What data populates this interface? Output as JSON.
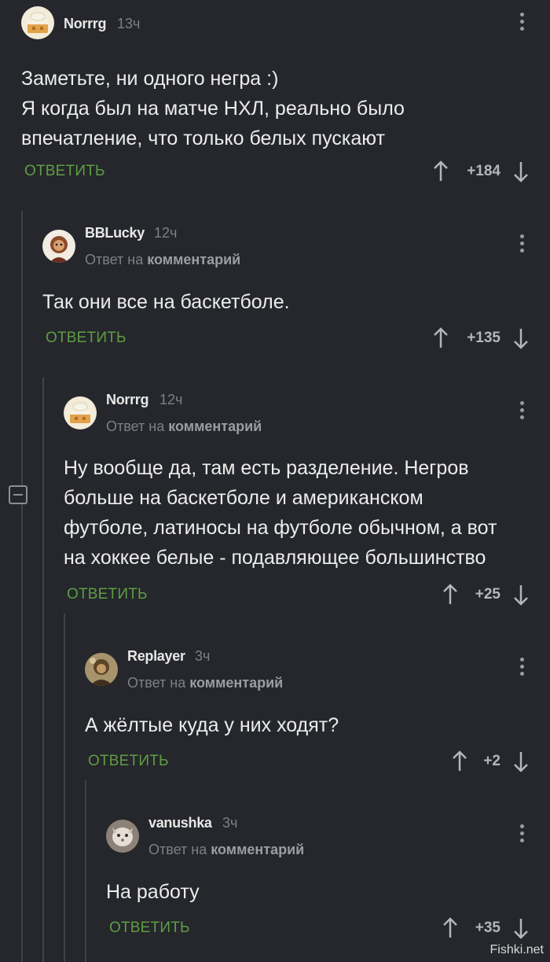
{
  "comments": [
    {
      "user": "Norrrg",
      "time": "13ч",
      "reply_prefix": "",
      "reply_target": "",
      "lines": [
        "Заметьте, ни одного негра :)",
        "Я когда был на матче НХЛ, реально было",
        "впечатление, что только белых пускают"
      ],
      "reply_label": "ОТВЕТИТЬ",
      "score": "+184"
    },
    {
      "user": "BBLucky",
      "time": "12ч",
      "reply_prefix": "Ответ на",
      "reply_target": "комментарий",
      "lines": [
        "Так они все на баскетболе."
      ],
      "reply_label": "ОТВЕТИТЬ",
      "score": "+135"
    },
    {
      "user": "Norrrg",
      "time": "12ч",
      "reply_prefix": "Ответ на",
      "reply_target": "комментарий",
      "lines": [
        "Ну вообще да, там есть разделение. Негров",
        "больше на баскетболе и американском",
        "футболе, латиносы на футболе обычном, а вот",
        "на хоккее белые - подавляющее большинство"
      ],
      "reply_label": "ОТВЕТИТЬ",
      "score": "+25"
    },
    {
      "user": "Replayer",
      "time": "3ч",
      "reply_prefix": "Ответ на",
      "reply_target": "комментарий",
      "lines": [
        "А жёлтые куда у них ходят?"
      ],
      "reply_label": "ОТВЕТИТЬ",
      "score": "+2"
    },
    {
      "user": "vanushka",
      "time": "3ч",
      "reply_prefix": "Ответ на",
      "reply_target": "комментарий",
      "lines": [
        "На работу"
      ],
      "reply_label": "ОТВЕТИТЬ",
      "score": "+35"
    }
  ],
  "watermark": "Fishki.net",
  "icons": {
    "menu": "kebab-menu-icon",
    "up": "arrow-up-icon",
    "down": "arrow-down-icon",
    "collapse": "collapse-minus-icon"
  },
  "colors": {
    "background": "#25272c",
    "reply": "#5e9d44",
    "muted": "#7d8085"
  }
}
